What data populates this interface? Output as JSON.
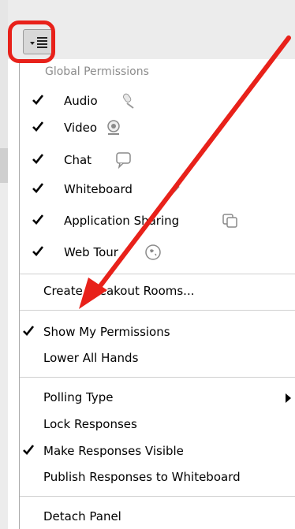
{
  "heading": "Global Permissions",
  "permissions": [
    {
      "label": "Audio",
      "checked": true,
      "icon": "microphone-icon"
    },
    {
      "label": "Video",
      "checked": true,
      "icon": "webcam-icon"
    },
    {
      "label": "Chat",
      "checked": true,
      "icon": "chat-bubble-icon"
    },
    {
      "label": "Whiteboard",
      "checked": true,
      "icon": "pencil-icon"
    },
    {
      "label": "Application Sharing",
      "checked": true,
      "icon": "app-share-icon"
    },
    {
      "label": "Web Tour",
      "checked": true,
      "icon": "globe-icon"
    }
  ],
  "menu": {
    "create_breakout": "Create Breakout Rooms...",
    "show_permissions": "Show My Permissions",
    "lower_hands": "Lower All Hands",
    "polling_type": "Polling Type",
    "lock_responses": "Lock Responses",
    "make_visible": "Make Responses Visible",
    "publish": "Publish Responses to Whiteboard",
    "detach": "Detach Panel"
  },
  "colors": {
    "annotation_red": "#e8211a",
    "heading_gray": "#8c8c8c"
  }
}
